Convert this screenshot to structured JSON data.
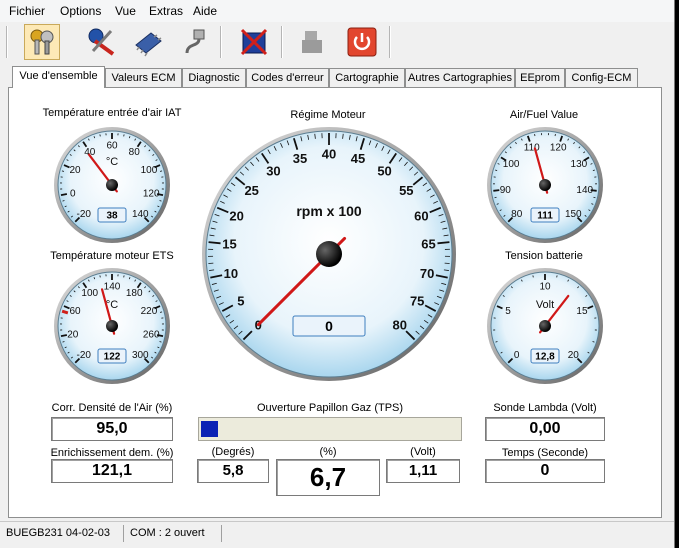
{
  "menu": [
    "Fichier",
    "Options",
    "Vue",
    "Extras",
    "Aide"
  ],
  "tabs": [
    "Vue d'ensemble",
    "Valeurs ECM",
    "Diagnostic",
    "Codes d'erreur",
    "Cartographie",
    "Autres Cartographies",
    "EEprom",
    "Config-ECM"
  ],
  "toolbar_icons": [
    "keys-icon",
    "tools-icon",
    "chip-icon",
    "cable-icon",
    "eeprom-cross-icon",
    "engine-icon",
    "power-icon"
  ],
  "gauges": {
    "iat": {
      "title": "Température entrée d'air IAT",
      "unit": "°C",
      "ticks": [
        "-20",
        "0",
        "20",
        "40",
        "60",
        "80",
        "100",
        "120",
        "140"
      ],
      "value": "38",
      "scale": {
        "min": -20,
        "max": 140
      }
    },
    "rpm": {
      "title": "Régime Moteur",
      "unit": "rpm x 100",
      "ticks": [
        "0",
        "5",
        "10",
        "15",
        "20",
        "25",
        "30",
        "35",
        "40",
        "45",
        "50",
        "55",
        "60",
        "65",
        "70",
        "75",
        "80"
      ],
      "value": "0",
      "scale": {
        "min": 0,
        "max": 80
      }
    },
    "afr": {
      "title": "Air/Fuel Value",
      "unit": "",
      "ticks": [
        "80",
        "90",
        "100",
        "110",
        "120",
        "130",
        "140",
        "150"
      ],
      "value": "111",
      "scale": {
        "min": 80,
        "max": 150
      }
    },
    "ets": {
      "title": "Température moteur ETS",
      "unit": "°C",
      "ticks": [
        "-20",
        "20",
        "60",
        "100",
        "140",
        "180",
        "220",
        "260",
        "300"
      ],
      "value": "122",
      "scale": {
        "min": -20,
        "max": 300
      }
    },
    "batt": {
      "title": "Tension batterie",
      "unit": "Volt",
      "ticks": [
        "0",
        "5",
        "10",
        "15",
        "20"
      ],
      "value": "12,8",
      "scale": {
        "min": 0,
        "max": 20
      }
    }
  },
  "readouts": {
    "air_density_label": "Corr. Densité de l'Air (%)",
    "air_density_value": "95,0",
    "enrichment_label": "Enrichissement dem. (%)",
    "enrichment_value": "121,1",
    "throttle_title": "Ouverture Papillon Gaz (TPS)",
    "throttle_fraction": 0.067,
    "degrees_label": "(Degrés)",
    "degrees_value": "5,8",
    "percent_label": "(%)",
    "percent_value": "6,7",
    "volt_label": "(Volt)",
    "volt_value": "1,11",
    "lambda_label": "Sonde Lambda (Volt)",
    "lambda_value": "0,00",
    "time_label": "Temps (Seconde)",
    "time_value": "0"
  },
  "status": {
    "ecm": "BUEGB231 04-02-03",
    "com": "COM : 2 ouvert"
  }
}
